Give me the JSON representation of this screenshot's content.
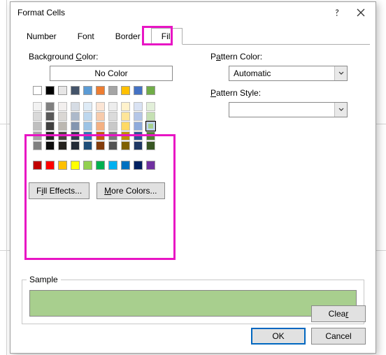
{
  "dialog": {
    "title": "Format Cells",
    "tabs": [
      "Number",
      "Font",
      "Border",
      "Fill"
    ],
    "active_tab": 3
  },
  "fill": {
    "bg_label": "Background Color:",
    "no_color": "No Color",
    "pattern_color_label": "Pattern Color:",
    "pattern_color_value": "Automatic",
    "pattern_style_label": "Pattern Style:",
    "fill_effects": "Fill Effects...",
    "more_colors": "More Colors...",
    "top_row": [
      "#ffffff",
      "#000000",
      "#e7e6e6",
      "#44546a",
      "#5b9bd5",
      "#ed7d31",
      "#a5a5a5",
      "#ffc000",
      "#4472c4",
      "#70ad47"
    ],
    "theme": [
      [
        "#f2f2f2",
        "#808080",
        "#f2efee",
        "#d6dce4",
        "#deebf6",
        "#fbe5d5",
        "#ededed",
        "#fff2cc",
        "#d9e2f3",
        "#e2efd9"
      ],
      [
        "#d9d9d9",
        "#595959",
        "#dad7d4",
        "#adb9ca",
        "#bdd7ee",
        "#f7cbac",
        "#dbdbdb",
        "#fee599",
        "#b4c6e7",
        "#c5e0b3"
      ],
      [
        "#bfbfbf",
        "#404040",
        "#bcb8b2",
        "#8496b0",
        "#9cc3e5",
        "#f4b183",
        "#c9c9c9",
        "#ffd965",
        "#8eaadb",
        "#a8d08d"
      ],
      [
        "#a6a6a6",
        "#262626",
        "#4a4540",
        "#323f4f",
        "#2e75b5",
        "#c55a11",
        "#7b7b7b",
        "#bf9000",
        "#2f5496",
        "#538135"
      ],
      [
        "#808080",
        "#0d0d0d",
        "#25221e",
        "#222a35",
        "#1e4e79",
        "#833c0b",
        "#525252",
        "#7f6000",
        "#1f3864",
        "#385623"
      ]
    ],
    "standard": [
      "#c00000",
      "#ff0000",
      "#ffc000",
      "#ffff00",
      "#92d050",
      "#00b050",
      "#00b0f0",
      "#0070c0",
      "#002060",
      "#7030a0"
    ],
    "selected_color": "#a8d08d"
  },
  "sample": {
    "label": "Sample",
    "color": "#a8cf8e"
  },
  "buttons": {
    "clear": "Clear",
    "ok": "OK",
    "cancel": "Cancel"
  }
}
